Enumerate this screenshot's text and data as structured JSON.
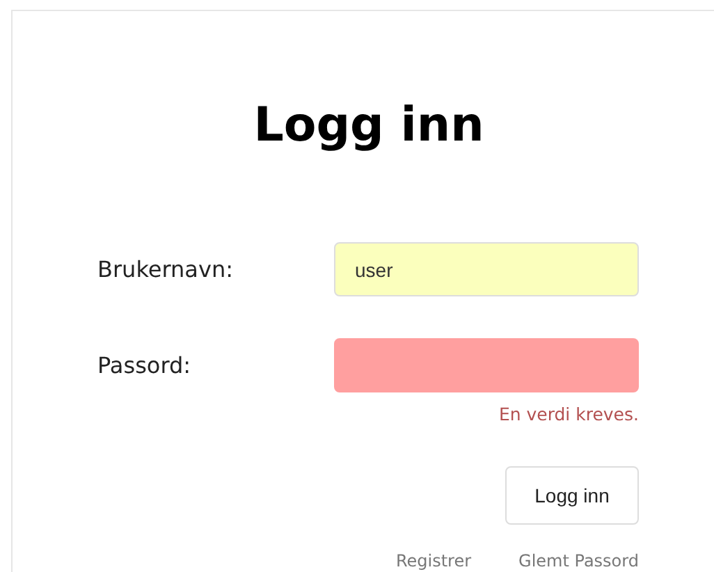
{
  "title": "Logg inn",
  "fields": [
    {
      "label": "Brukernavn:",
      "value": "user",
      "autofilled": true,
      "invalid": false
    },
    {
      "label": "Passord:",
      "autofilled": false,
      "invalid": true,
      "error": "En verdi kreves."
    }
  ],
  "submit": "Logg inn",
  "links": [
    "Registrer",
    "Glemt Passord"
  ]
}
